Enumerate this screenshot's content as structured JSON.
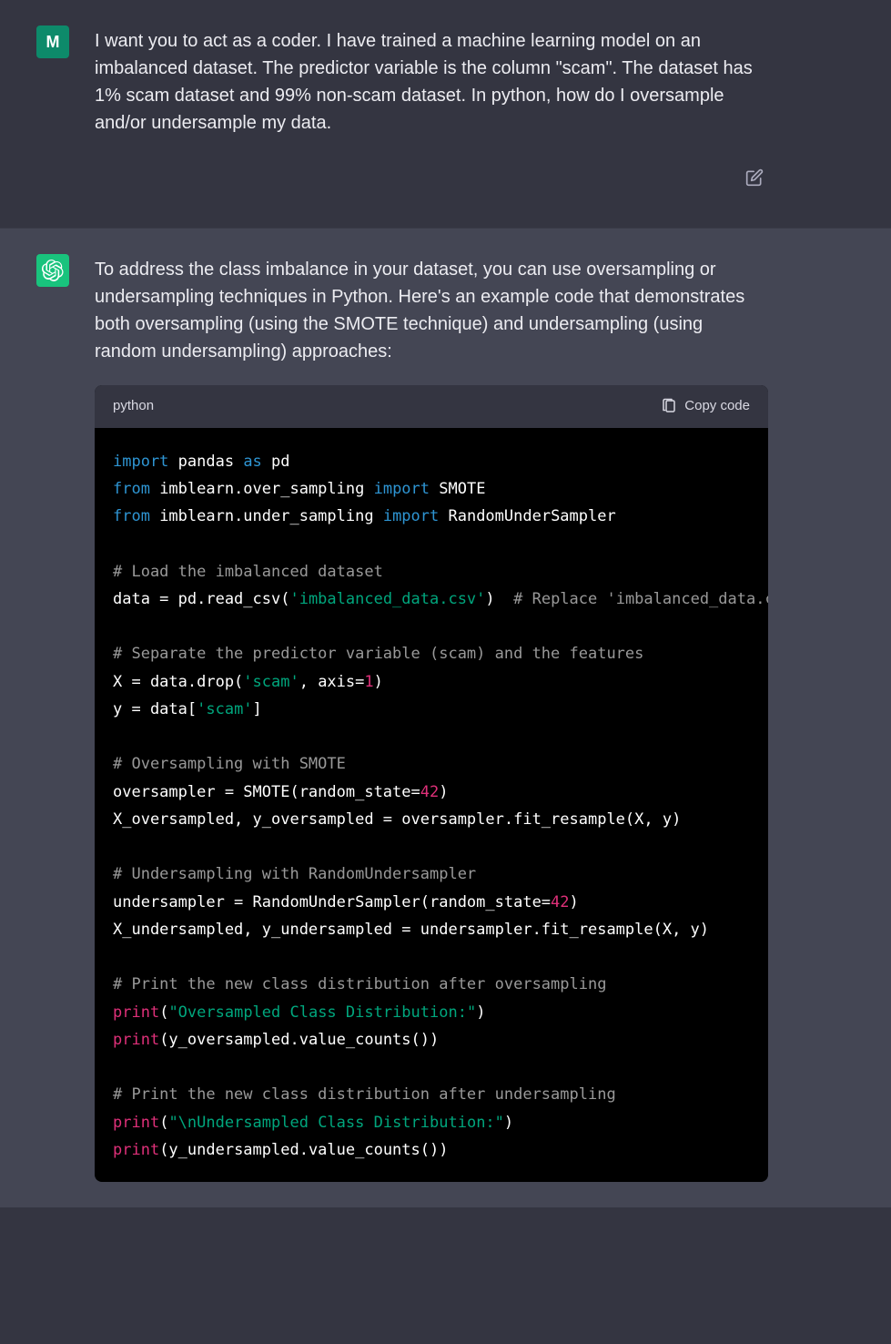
{
  "user": {
    "avatar_letter": "M",
    "text": "I want you to act as a coder. I have trained a machine learning model on an imbalanced dataset. The predictor variable is the column \"scam\". The dataset has 1% scam dataset and 99% non-scam dataset. In python, how do I oversample and/or undersample my data."
  },
  "assistant": {
    "text": "To address the class imbalance in your dataset, you can use oversampling or undersampling techniques in Python. Here's an example code that demonstrates both oversampling (using the SMOTE technique) and undersampling (using random undersampling) approaches:"
  },
  "code": {
    "lang": "python",
    "copy_label": "Copy code",
    "tokens": {
      "kw_import": "import",
      "kw_from": "from",
      "kw_as": "as",
      "mod_pandas": " pandas ",
      "id_pd": " pd",
      "mod_over": " imblearn.over_sampling ",
      "id_smote": " SMOTE",
      "mod_under": " imblearn.under_sampling ",
      "id_rus": " RandomUnderSampler",
      "cmt_load": "# Load the imbalanced dataset",
      "l_data_eq": "data = pd.read_csv(",
      "str_csv": "'imbalanced_data.csv'",
      "l_data_close": ")  ",
      "cmt_replace": "# Replace 'imbalanced_data.csv' with your file",
      "cmt_separate": "# Separate the predictor variable (scam) and the features",
      "l_X1": "X = data.drop(",
      "str_scam1": "'scam'",
      "l_X2": ", axis=",
      "num_1": "1",
      "l_X3": ")",
      "l_y1": "y = data[",
      "str_scam2": "'scam'",
      "l_y2": "]",
      "cmt_over": "# Oversampling with SMOTE",
      "l_os1": "oversampler = SMOTE(random_state=",
      "num_42a": "42",
      "l_os2": ")",
      "l_os_fit": "X_oversampled, y_oversampled = oversampler.fit_resample(X, y)",
      "cmt_under": "# Undersampling with RandomUndersampler",
      "l_us1": "undersampler = RandomUnderSampler(random_state=",
      "num_42b": "42",
      "l_us2": ")",
      "l_us_fit": "X_undersampled, y_undersampled = undersampler.fit_resample(X, y)",
      "cmt_print_over": "# Print the new class distribution after oversampling",
      "bi_print1": "print",
      "l_p1a": "(",
      "str_over_dist": "\"Oversampled Class Distribution:\"",
      "l_p1b": ")",
      "bi_print2": "print",
      "l_p2": "(y_oversampled.value_counts())",
      "cmt_print_under": "# Print the new class distribution after undersampling",
      "bi_print3": "print",
      "l_p3a": "(",
      "str_under_dist": "\"\\nUndersampled Class Distribution:\"",
      "l_p3b": ")",
      "bi_print4": "print",
      "l_p4": "(y_undersampled.value_counts())"
    }
  }
}
